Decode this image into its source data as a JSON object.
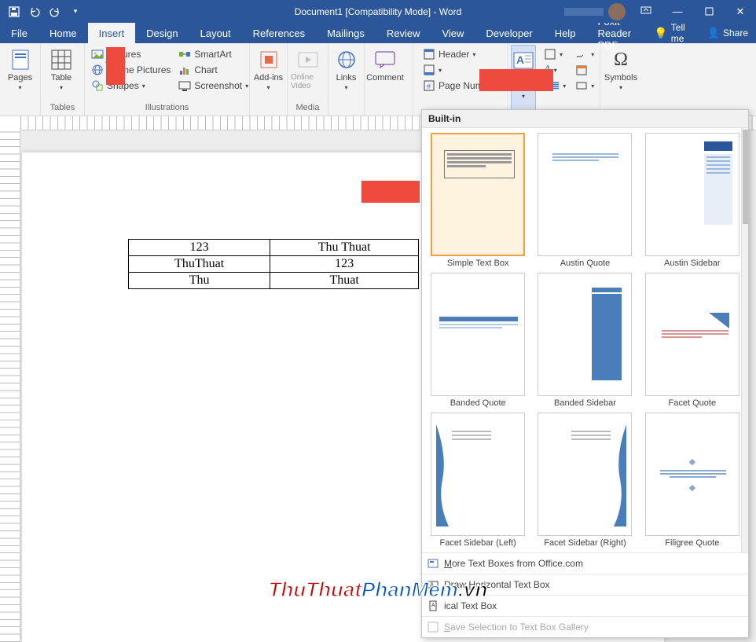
{
  "titlebar": {
    "title": "Document1 [Compatibility Mode] - Word"
  },
  "tabs": {
    "file": "File",
    "home": "Home",
    "insert": "Insert",
    "design": "Design",
    "layout": "Layout",
    "references": "References",
    "mailings": "Mailings",
    "review": "Review",
    "view": "View",
    "developer": "Developer",
    "help": "Help",
    "foxit": "Foxit Reader PDF",
    "tell": "Tell me",
    "share": "Share"
  },
  "ribbon": {
    "pages": "Pages",
    "pages_lbl": "Pages",
    "table": "Table",
    "tables_lbl": "Tables",
    "pictures": "Pictures",
    "online_pics": "Online Pictures",
    "shapes": "Shapes",
    "smartart": "SmartArt",
    "chart": "Chart",
    "screenshot": "Screenshot",
    "illus_lbl": "Illustrations",
    "addins": "Add-ins",
    "media": "Media",
    "online_video": "Online Video",
    "links": "Links",
    "comment": "Comment",
    "header": "Header",
    "footer": "Footer",
    "page_number": "Page Number",
    "textbox": "Text Box",
    "symbols": "Symbols"
  },
  "doc": {
    "r1c1": "123",
    "r1c2": "Thu Thuat",
    "r2c1": "ThuThuat",
    "r2c2": "123",
    "r3c1": "Thu",
    "r3c2": "Thuat"
  },
  "dropdown": {
    "header": "Built-in",
    "items": [
      "Simple Text Box",
      "Austin Quote",
      "Austin Sidebar",
      "Banded Quote",
      "Banded Sidebar",
      "Facet Quote",
      "Facet Sidebar (Left)",
      "Facet Sidebar (Right)",
      "Filigree Quote"
    ],
    "more": "More Text Boxes from Office.com",
    "draw_h": "Draw Horizontal Text Box",
    "draw_v": "ical Text Box",
    "save_gallery": "Save Selection to Text Box Gallery"
  },
  "watermark": {
    "p1": "ThuThuat",
    "p2": "PhanMem",
    "p3": ".vn"
  }
}
